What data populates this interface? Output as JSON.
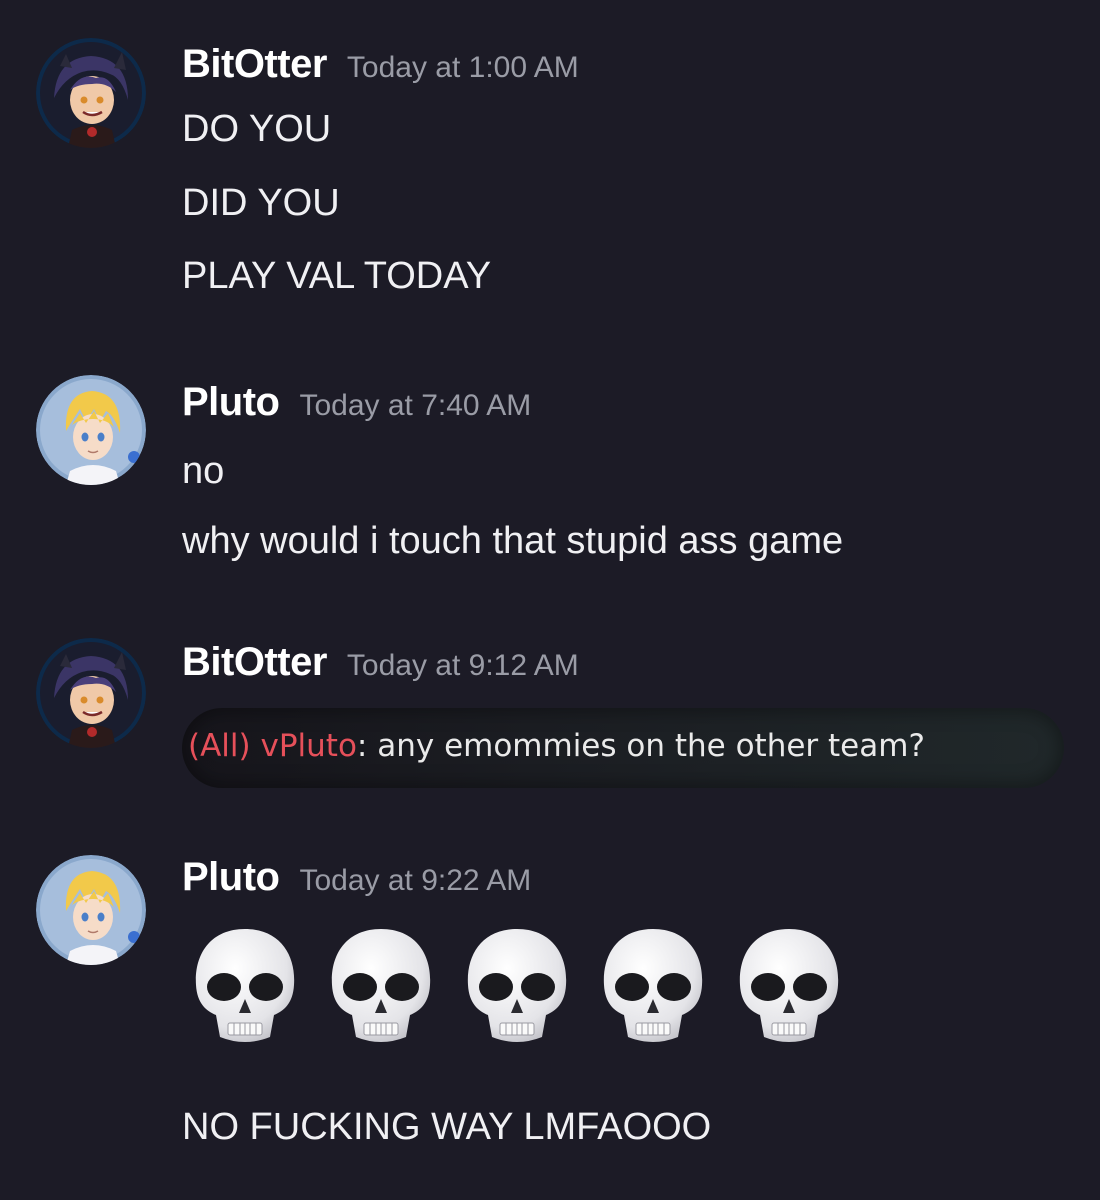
{
  "messages": [
    {
      "user": "BitOtter",
      "timestamp": "Today at 1:00 AM",
      "avatar_icon": "bitotter-avatar-icon",
      "lines": [
        "DO YOU",
        "DID YOU",
        "PLAY VAL TODAY"
      ]
    },
    {
      "user": "Pluto",
      "timestamp": "Today at 7:40 AM",
      "avatar_icon": "pluto-avatar-icon",
      "lines": [
        "no",
        "why would i touch that stupid ass game"
      ]
    },
    {
      "user": "BitOtter",
      "timestamp": "Today at 9:12 AM",
      "avatar_icon": "bitotter-avatar-icon",
      "attachment": {
        "channel": "(All)",
        "player": "vPluto",
        "separator": ":",
        "text": "any emommies on the other team?"
      }
    },
    {
      "user": "Pluto",
      "timestamp": "Today at 9:22 AM",
      "avatar_icon": "pluto-avatar-icon",
      "emojis": [
        "skull-emoji",
        "skull-emoji",
        "skull-emoji",
        "skull-emoji",
        "skull-emoji"
      ],
      "lines": [
        "NO FUCKING WAY LMFAOOO"
      ]
    }
  ],
  "colors": {
    "background": "#1c1b26",
    "username": "#ffffff",
    "timestamp": "#9a9ca6",
    "game_chat_red": "#e6505a"
  }
}
